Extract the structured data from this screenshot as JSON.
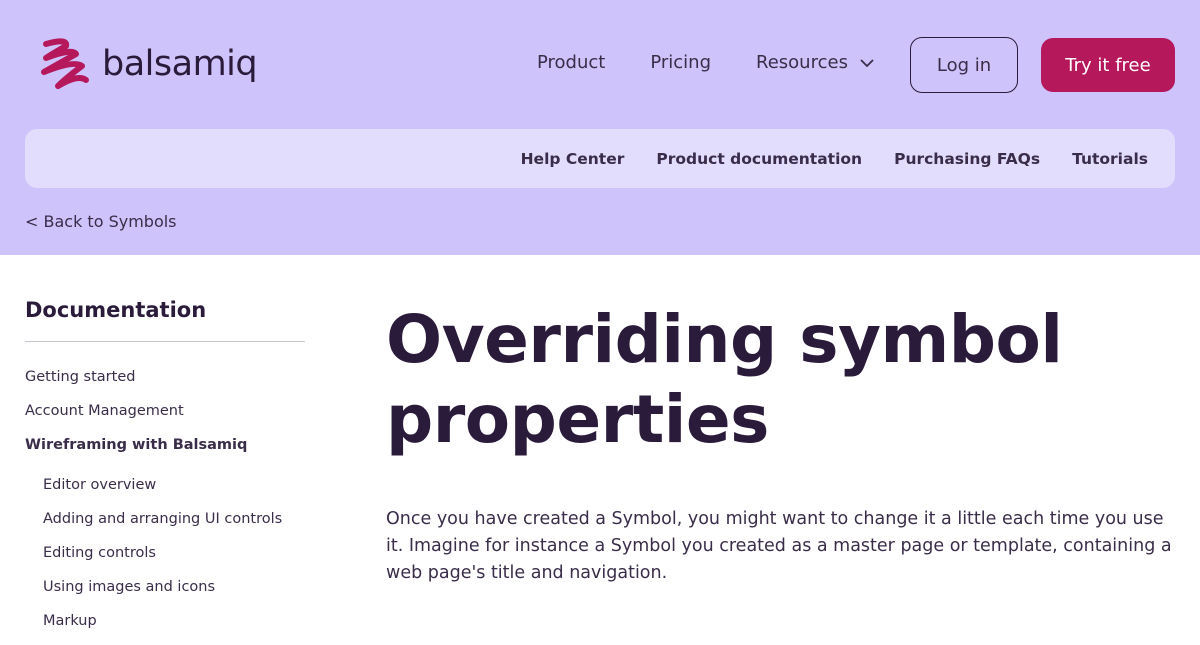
{
  "brand": {
    "name": "balsamiq",
    "accent": "#b5195b",
    "header_bg": "#cfc3fb",
    "subnav_bg": "#e2dcfd"
  },
  "main_nav": {
    "items": [
      "Product",
      "Pricing",
      "Resources"
    ],
    "login_label": "Log in",
    "cta_label": "Try it free"
  },
  "sub_nav": {
    "items": [
      "Help Center",
      "Product documentation",
      "Purchasing FAQs",
      "Tutorials"
    ]
  },
  "back_link": "< Back to Symbols",
  "sidebar": {
    "title": "Documentation",
    "items": [
      "Getting started",
      "Account Management",
      "Wireframing with Balsamiq"
    ],
    "sub_items": [
      "Editor overview",
      "Adding and arranging UI controls",
      "Editing controls",
      "Using images and icons",
      "Markup"
    ]
  },
  "article": {
    "title": "Overriding symbol properties",
    "intro": "Once you have created a Symbol, you might want to change it a little each time you use it. Imagine for instance a Symbol you created as a master page or template, containing a web page's title and navigation."
  },
  "icons": {
    "logo": "squiggle-logo-icon",
    "resources": "chevron-down-icon"
  }
}
